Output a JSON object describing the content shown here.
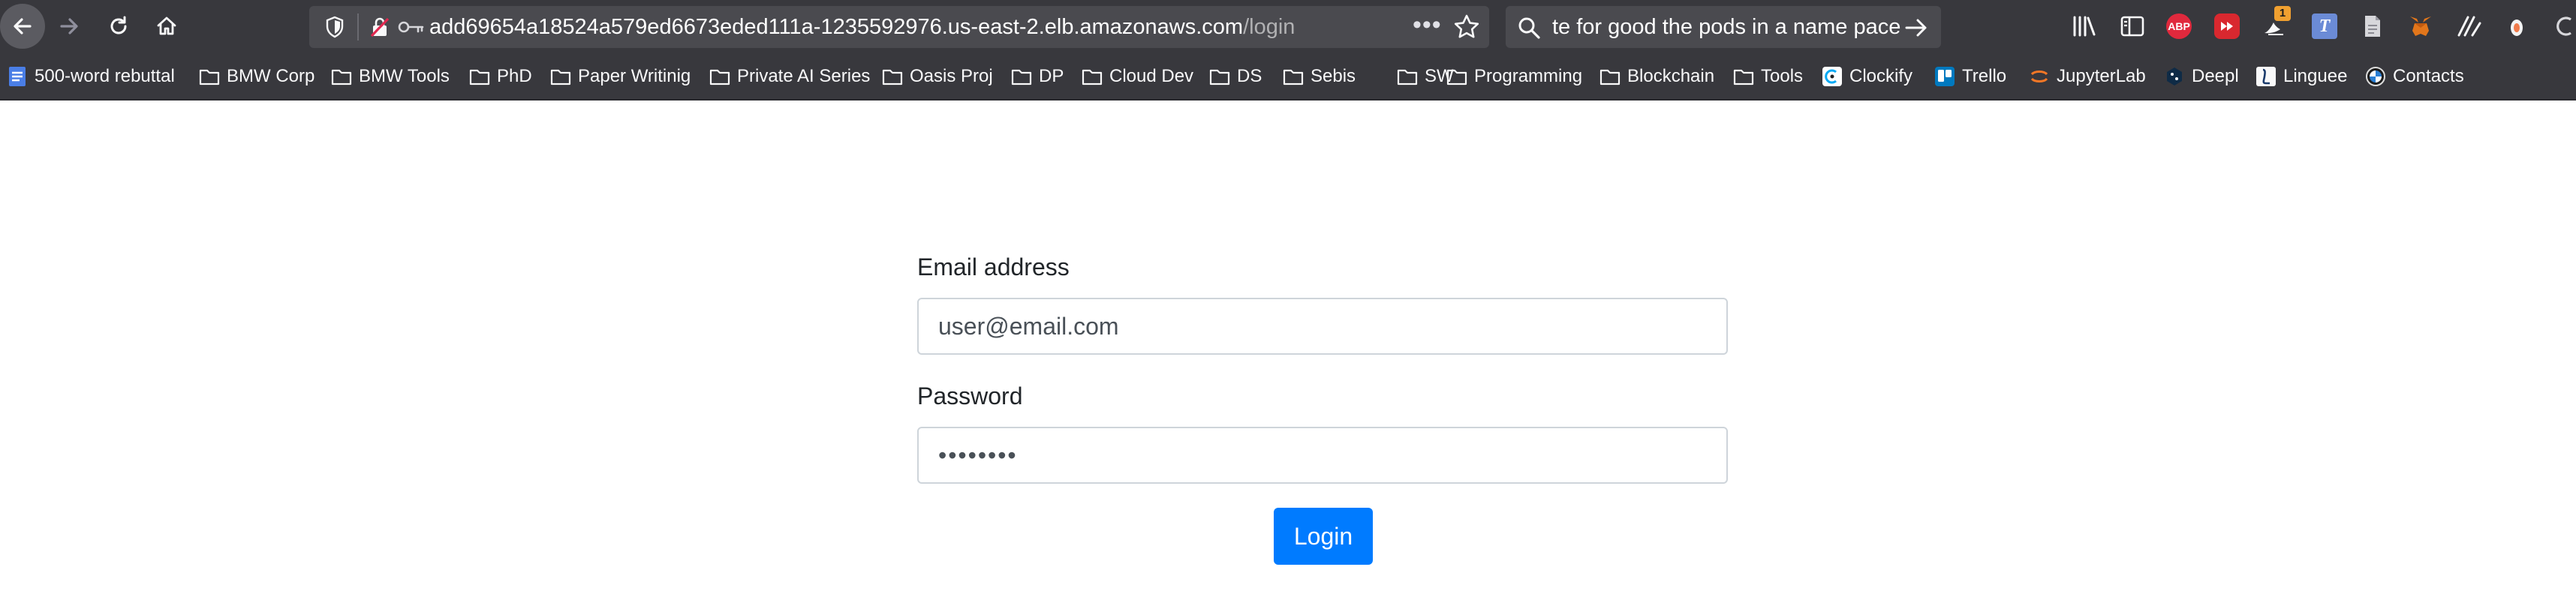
{
  "browser": {
    "url_host": "add69654a18524a579ed6673eded111a-1235592976.us-east-2.elb.amazonaws.com",
    "url_path": "/login",
    "url_more": "•••",
    "search_text": "te for good the pods in a name pace",
    "extensions": [
      {
        "name": "library-icon"
      },
      {
        "name": "sidebar-icon"
      },
      {
        "name": "adblock-plus-icon",
        "label": "ABP"
      },
      {
        "name": "youtube-icon"
      },
      {
        "name": "notification-badge-icon",
        "badge": "1"
      },
      {
        "name": "translate-icon",
        "label": "T"
      },
      {
        "name": "document-icon"
      },
      {
        "name": "metamask-icon"
      },
      {
        "name": "stats-icon"
      },
      {
        "name": "shield-extension-icon"
      },
      {
        "name": "overflow-icon"
      }
    ]
  },
  "bookmarks": [
    {
      "label": "500-word rebuttal",
      "icon": "docs-icon"
    },
    {
      "label": "BMW Corp",
      "icon": "folder-icon"
    },
    {
      "label": "BMW Tools",
      "icon": "folder-icon"
    },
    {
      "label": "PhD",
      "icon": "folder-icon"
    },
    {
      "label": "Paper Writinig",
      "icon": "folder-icon"
    },
    {
      "label": "Private AI Series",
      "icon": "folder-icon"
    },
    {
      "label": "Oasis Proj",
      "icon": "folder-icon"
    },
    {
      "label": "DP",
      "icon": "folder-icon"
    },
    {
      "label": "Cloud Dev",
      "icon": "folder-icon"
    },
    {
      "label": "DS",
      "icon": "folder-icon"
    },
    {
      "label": "Sebis",
      "icon": "folder-icon"
    },
    {
      "label": "SW",
      "icon": "folder-icon"
    },
    {
      "label": "Programming",
      "icon": "folder-icon"
    },
    {
      "label": "Blockchain",
      "icon": "folder-icon"
    },
    {
      "label": "Tools",
      "icon": "folder-icon"
    },
    {
      "label": "Clockify",
      "icon": "clockify-icon"
    },
    {
      "label": "Trello",
      "icon": "trello-icon"
    },
    {
      "label": "JupyterLab",
      "icon": "jupyter-icon"
    },
    {
      "label": "Deepl",
      "icon": "deepl-icon"
    },
    {
      "label": "Linguee",
      "icon": "linguee-icon"
    },
    {
      "label": "Contacts",
      "icon": "bmw-icon"
    }
  ],
  "login": {
    "email_label": "Email address",
    "email_value": "user@email.com",
    "password_label": "Password",
    "password_value": "password",
    "button_label": "Login"
  },
  "colors": {
    "chrome": "#38383d",
    "field": "#4a4a4f",
    "primary": "#007bff",
    "text": "#212529",
    "border": "#ced4da"
  }
}
